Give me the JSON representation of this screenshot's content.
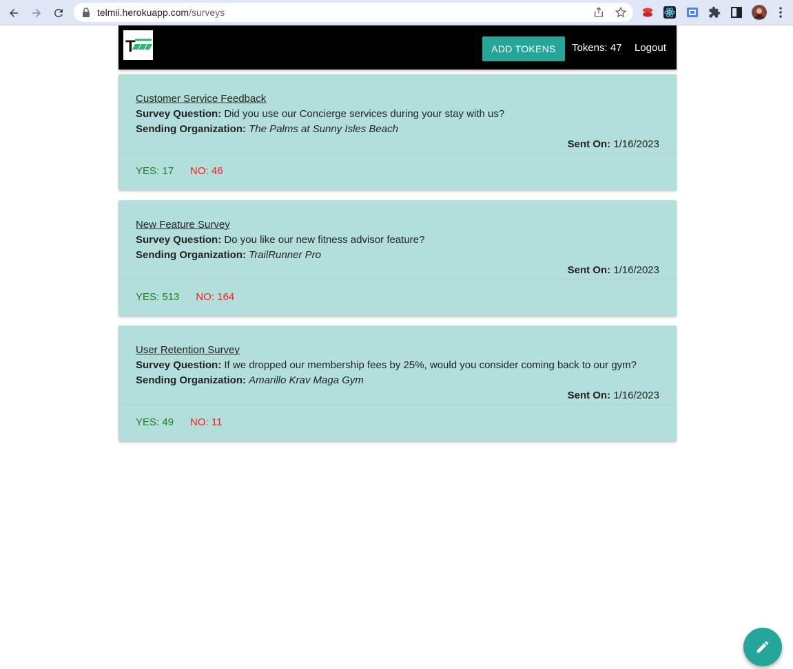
{
  "browser": {
    "url_host": "telmii.herokuapp.com",
    "url_path": "/surveys"
  },
  "navbar": {
    "logo_text": "T",
    "add_tokens_label": "ADD TOKENS",
    "tokens_label": "Tokens: 47",
    "logout_label": "Logout"
  },
  "labels": {
    "question": "Survey Question:",
    "organization": "Sending Organization:",
    "sent_on": "Sent On:"
  },
  "surveys": [
    {
      "title": "Customer Service Feedback",
      "question": "Did you use our Concierge services during your stay with us?",
      "organization": "The Palms at Sunny Isles Beach",
      "sent_on": "1/16/2023",
      "yes": "YES: 17",
      "no": "NO: 46"
    },
    {
      "title": "New Feature Survey",
      "question": "Do you like our new fitness advisor feature?",
      "organization": "TrailRunner Pro",
      "sent_on": "1/16/2023",
      "yes": "YES: 513",
      "no": "NO: 164"
    },
    {
      "title": "User Retention Survey",
      "question": "If we dropped our membership fees by 25%, would you consider coming back to our gym?",
      "organization": "Amarillo Krav Maga Gym",
      "sent_on": "1/16/2023",
      "yes": "YES: 49",
      "no": "NO: 11"
    }
  ],
  "colors": {
    "accent": "#26a69a",
    "card_background": "#b2dfdb",
    "yes": "#1b7f1b",
    "no": "#ff1a1a",
    "navbar": "#000000"
  },
  "icons": {
    "back": "back-arrow-icon",
    "forward": "forward-arrow-icon",
    "reload": "reload-icon",
    "lock": "lock-icon",
    "share": "share-icon",
    "bookmark": "star-icon",
    "fab": "pencil-icon"
  }
}
